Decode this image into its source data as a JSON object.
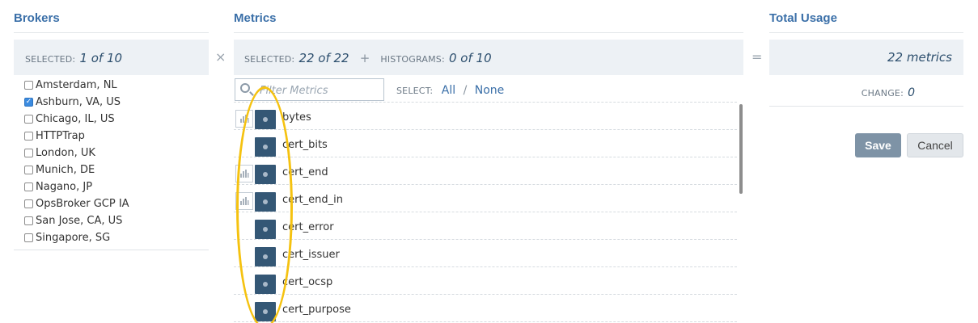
{
  "brokers": {
    "heading": "Brokers",
    "selected_label": "SELECTED:",
    "selected_value": "1 of 10",
    "items": [
      {
        "label": "Amsterdam, NL",
        "checked": false
      },
      {
        "label": "Ashburn, VA, US",
        "checked": true
      },
      {
        "label": "Chicago, IL, US",
        "checked": false
      },
      {
        "label": "HTTPTrap",
        "checked": false
      },
      {
        "label": "London, UK",
        "checked": false
      },
      {
        "label": "Munich, DE",
        "checked": false
      },
      {
        "label": "Nagano, JP",
        "checked": false
      },
      {
        "label": "OpsBroker GCP IA",
        "checked": false
      },
      {
        "label": "San Jose, CA, US",
        "checked": false
      },
      {
        "label": "Singapore, SG",
        "checked": false
      }
    ]
  },
  "operators": {
    "times": "×",
    "equals": "="
  },
  "metrics": {
    "heading": "Metrics",
    "selected_label": "SELECTED:",
    "selected_value": "22 of 22",
    "plus": "+",
    "histograms_label": "HISTOGRAMS:",
    "histograms_value": "0 of 10",
    "filter_placeholder": "Filter Metrics",
    "select_label": "SELECT:",
    "select_all": "All",
    "select_sep": "/",
    "select_none": "None",
    "items": [
      {
        "name": "bytes",
        "histogram": true
      },
      {
        "name": "cert_bits",
        "histogram": false
      },
      {
        "name": "cert_end",
        "histogram": true
      },
      {
        "name": "cert_end_in",
        "histogram": true
      },
      {
        "name": "cert_error",
        "histogram": false
      },
      {
        "name": "cert_issuer",
        "histogram": false
      },
      {
        "name": "cert_ocsp",
        "histogram": false
      },
      {
        "name": "cert_purpose",
        "histogram": false
      }
    ]
  },
  "usage": {
    "heading": "Total Usage",
    "total_value": "22 metrics",
    "change_label": "CHANGE:",
    "change_value": "0",
    "save_label": "Save",
    "cancel_label": "Cancel"
  },
  "colors": {
    "heading": "#3a6fa8",
    "toggle": "#345775",
    "annotation": "#f5c210",
    "save_button": "#7e93a6"
  }
}
